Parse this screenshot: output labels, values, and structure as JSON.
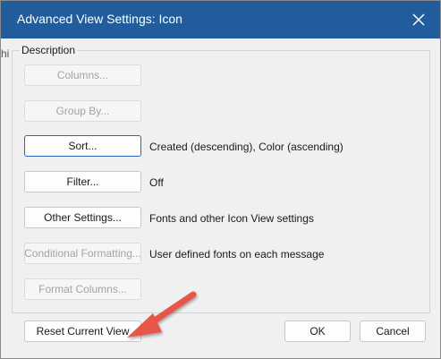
{
  "window": {
    "title": "Advanced View Settings: Icon"
  },
  "group": {
    "label": "Description",
    "clipped_text": "hi"
  },
  "rows": [
    {
      "button": "Columns...",
      "description": "",
      "enabled": false
    },
    {
      "button": "Group By...",
      "description": "",
      "enabled": false
    },
    {
      "button": "Sort...",
      "description": "Created (descending), Color (ascending)",
      "enabled": true
    },
    {
      "button": "Filter...",
      "description": "Off",
      "enabled": true
    },
    {
      "button": "Other Settings...",
      "description": "Fonts and other Icon View settings",
      "enabled": true
    },
    {
      "button": "Conditional Formatting...",
      "description": "User defined fonts on each message",
      "enabled": false
    },
    {
      "button": "Format Columns...",
      "description": "",
      "enabled": false
    }
  ],
  "footer": {
    "reset_label": "Reset Current View",
    "ok_label": "OK",
    "cancel_label": "Cancel"
  },
  "colors": {
    "titlebar": "#215d9c",
    "arrow": "#e8564a"
  },
  "icons": {
    "close": "close-icon",
    "arrow": "arrow-icon"
  }
}
